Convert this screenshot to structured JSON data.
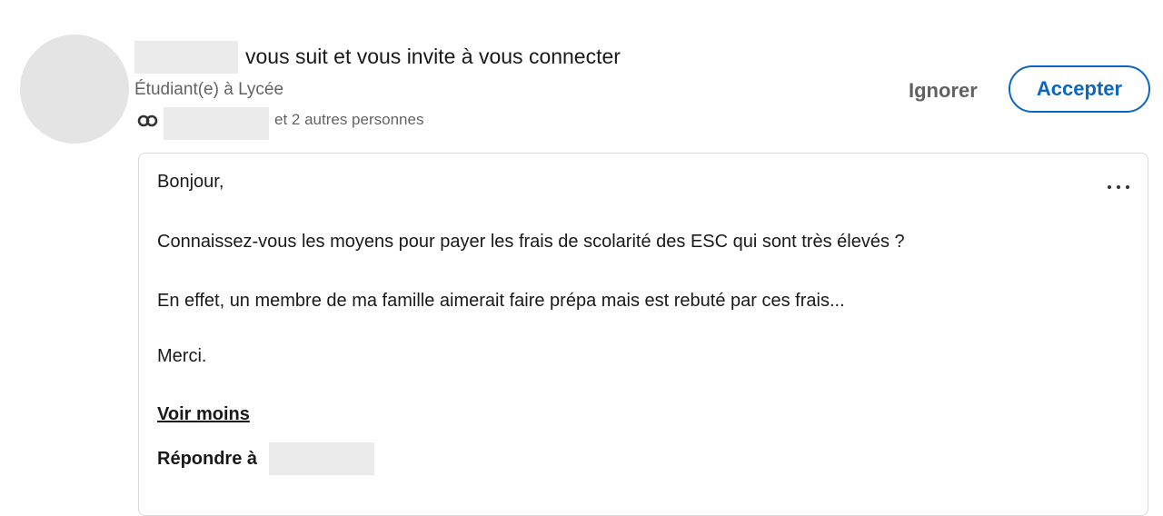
{
  "invitation": {
    "headline_suffix": "vous suit et vous invite à vous connecter",
    "sender_title": "Étudiant(e) à Lycée",
    "mutual_text": "et 2 autres personnes",
    "ignore_label": "Ignorer",
    "accept_label": "Accepter",
    "accent_color": "#0a66c2"
  },
  "message": {
    "lines": [
      "Bonjour,",
      "Connaissez-vous les moyens pour payer les frais de scolarité des ESC qui sont très élevés ?",
      "En effet, un membre de ma famille aimerait faire prépa mais est rebuté par ces frais...",
      "Merci."
    ],
    "see_less_label": "Voir moins",
    "reply_label": "Répondre à",
    "more_icon": "more-horizontal-icon"
  }
}
